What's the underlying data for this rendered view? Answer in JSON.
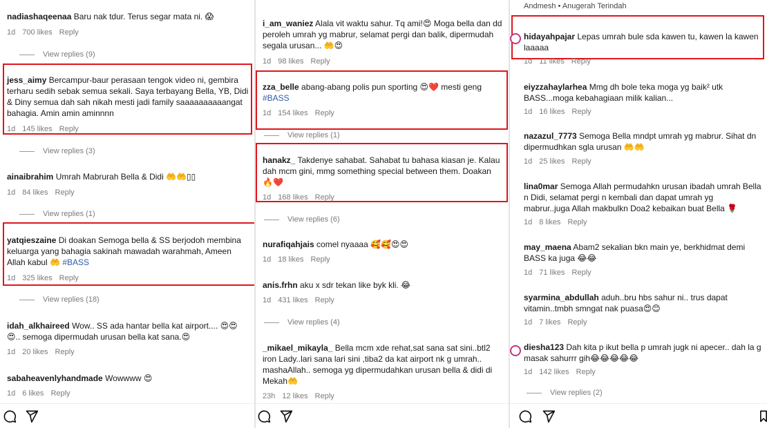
{
  "col1": {
    "c1": {
      "user": "nadiashaqeenaa",
      "text": "Baru nak tdur. Terus segar mata ni. 😱",
      "time": "1d",
      "likes": "700 likes",
      "reply": "Reply"
    },
    "vr1": "View replies (9)",
    "c2": {
      "user": "jess_aimy",
      "text": "Bercampur-baur perasaan tengok video ni, gembira terharu sedih sebak semua sekali. Saya terbayang Bella, YB, Didi & Diny semua dah sah nikah mesti jadi family saaaaaaaaaangat bahagia. Amin amin aminnnn",
      "time": "1d",
      "likes": "145 likes",
      "reply": "Reply"
    },
    "vr2": "View replies (3)",
    "c3": {
      "user": "ainaibrahim",
      "text": "Umrah Mabrurah Bella & Didi 🤲🤲▯▯",
      "time": "1d",
      "likes": "84 likes",
      "reply": "Reply"
    },
    "vr3": "View replies (1)",
    "c4": {
      "user": "yatqieszaine",
      "text": "Di doakan Semoga bella & SS berjodoh membina keluarga yang bahagia sakinah mawadah warahmah, Ameen Allah kabul 🤲",
      "tag": "#BASS",
      "time": "1d",
      "likes": "325 likes",
      "reply": "Reply"
    },
    "vr4": "View replies (18)",
    "c5": {
      "user": "idah_alkhaireed",
      "text": "Wow.. SS ada hantar bella kat airport.... 😍😍😍.. semoga dipermudah urusan bella kat sana.😍",
      "time": "1d",
      "likes": "20 likes",
      "reply": "Reply"
    },
    "c6": {
      "user": "sabaheavenlyhandmade",
      "text": "Wowwww 😍",
      "time": "1d",
      "likes": "6 likes",
      "reply": "Reply"
    }
  },
  "col2": {
    "c1": {
      "user": "i_am_waniez",
      "text": "Alala vit waktu sahur. Tq ami!😍 Moga bella dan dd peroleh umrah yg mabrur, selamat pergi dan balik, dipermudah segala urusan... 🤲😍",
      "time": "1d",
      "likes": "98 likes",
      "reply": "Reply"
    },
    "c2": {
      "user": "zza_belle",
      "text": "abang-abang polis pun sporting 😍❤️ mesti geng",
      "tag": "#BASS",
      "time": "1d",
      "likes": "154 likes",
      "reply": "Reply"
    },
    "vr1": "View replies (1)",
    "c3": {
      "user": "hanakz_",
      "text": "Takdenye sahabat. Sahabat tu bahasa kiasan je. Kalau dah mcm gini, mmg something special between them. Doakan 🔥❤️",
      "time": "1d",
      "likes": "168 likes",
      "reply": "Reply"
    },
    "vr2": "View replies (6)",
    "c4": {
      "user": "nurafiqahjais",
      "text": "comel nyaaaa 🥰🥰😍😍",
      "time": "1d",
      "likes": "18 likes",
      "reply": "Reply"
    },
    "c5": {
      "user": "anis.frhn",
      "text": "aku x sdr tekan like byk kli. 😂",
      "time": "1d",
      "likes": "431 likes",
      "reply": "Reply"
    },
    "vr3": "View replies (4)",
    "c6": {
      "user": "_mikael_mikayla_",
      "text": "Bella mcm xde rehat,sat sana sat sini..btl2 iron Lady..lari sana lari sini ,tiba2 da kat airport nk g umrah.. mashaAllah.. semoga yg dipermudahkan urusan bella & didi di Mekah🤲",
      "time": "23h",
      "likes": "12 likes",
      "reply": "Reply"
    }
  },
  "col3": {
    "top": "Andmesh • Anugerah Terindah",
    "c1": {
      "user": "hidayahpajar",
      "text": "Lepas umrah bule sda kawen tu, kawen la kawen laaaaa",
      "time": "1d",
      "likes": "11 likes",
      "reply": "Reply"
    },
    "c2": {
      "user": "eiyzzahaylarhea",
      "text": "Mmg dh bole teka moga yg baik² utk BASS...moga kebahagiaan milik kalian...",
      "time": "1d",
      "likes": "16 likes",
      "reply": "Reply"
    },
    "c3": {
      "user": "nazazul_7773",
      "text": "Semoga Bella mndpt umrah yg mabrur. Sihat dn dipermudhkan sgla urusan 🤲🤲",
      "time": "1d",
      "likes": "25 likes",
      "reply": "Reply"
    },
    "c4": {
      "user": "lina0mar",
      "text": "Semoga Allah permudahkn urusan ibadah umrah Bella n Didi, selamat pergi n kembali dan dapat umrah yg mabrur..juga Allah makbulkn Doa2 kebaikan buat Bella 🌹",
      "time": "1d",
      "likes": "8 likes",
      "reply": "Reply"
    },
    "c5": {
      "user": "may_maena",
      "text": "Abam2 sekalian bkn main ye, berkhidmat demi BASS ka juga 😂😂",
      "time": "1d",
      "likes": "71 likes",
      "reply": "Reply"
    },
    "c6": {
      "user": "syarmina_abdullah",
      "text": "aduh..bru hbs sahur ni.. trus dapat vitamin..tmbh smngat nak puasa😍😊",
      "time": "1d",
      "likes": "7 likes",
      "reply": "Reply"
    },
    "c7": {
      "user": "diesha123",
      "text": "Dah kita p ikut bella p umrah jugk ni apecer.. dah la g masak sahurrr gih😂😂😂😂😂",
      "time": "1d",
      "likes": "142 likes",
      "reply": "Reply"
    },
    "vr1": "View replies (2)"
  }
}
